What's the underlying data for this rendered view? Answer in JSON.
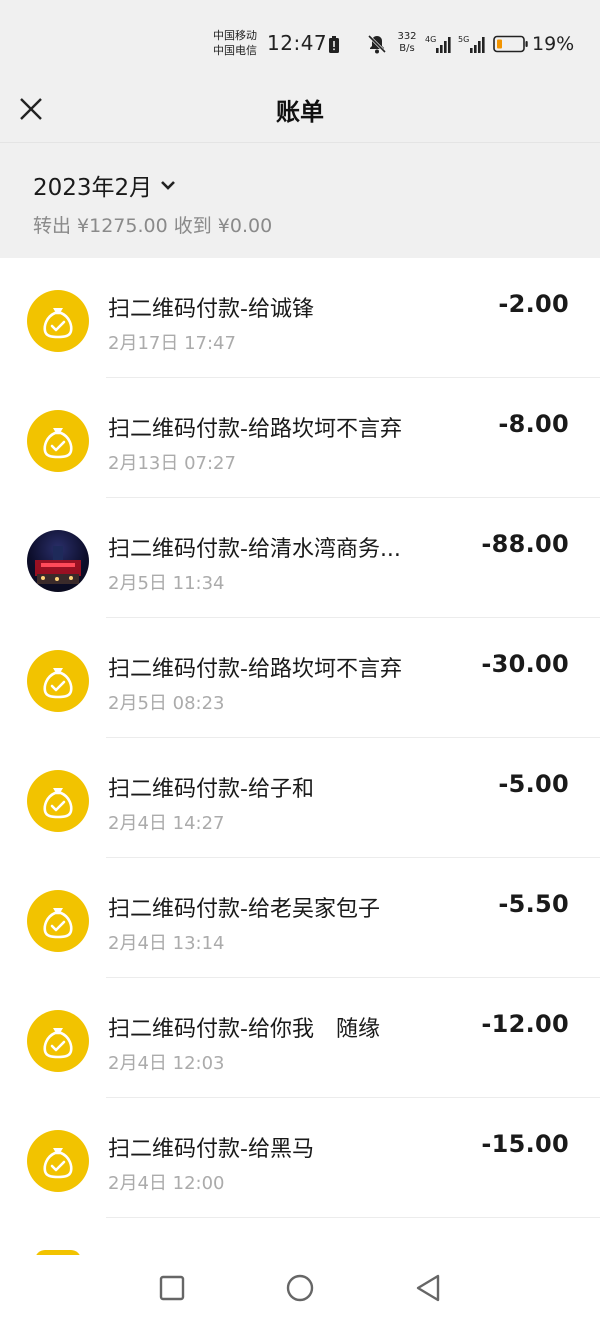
{
  "status_bar": {
    "carrier_1": "中国移动",
    "carrier_2": "中国电信",
    "time": "12:47",
    "net_speed_value": "332",
    "net_speed_unit": "B/s",
    "signal_1_label": "4G",
    "signal_2_label": "5G",
    "battery_percent": "19%"
  },
  "header": {
    "title": "账单",
    "close_icon": "close-icon"
  },
  "summary": {
    "month": "2023年2月",
    "totals": "转出 ¥1275.00 收到 ¥0.00"
  },
  "transactions": [
    {
      "title": "扫二维码付款-给诚锋",
      "date": "2月17日 17:47",
      "amount": "-2.00",
      "avatar": "money-bag-icon"
    },
    {
      "title": "扫二维码付款-给路坎坷不言弃",
      "date": "2月13日 07:27",
      "amount": "-8.00",
      "avatar": "money-bag-icon"
    },
    {
      "title": "扫二维码付款-给清水湾商务...",
      "date": "2月5日 11:34",
      "amount": "-88.00",
      "avatar": "merchant-photo"
    },
    {
      "title": "扫二维码付款-给路坎坷不言弃",
      "date": "2月5日 08:23",
      "amount": "-30.00",
      "avatar": "money-bag-icon"
    },
    {
      "title": "扫二维码付款-给子和",
      "date": "2月4日 14:27",
      "amount": "-5.00",
      "avatar": "money-bag-icon"
    },
    {
      "title": "扫二维码付款-给老吴家包子",
      "date": "2月4日 13:14",
      "amount": "-5.50",
      "avatar": "money-bag-icon"
    },
    {
      "title": "扫二维码付款-给你我　随缘",
      "date": "2月4日 12:03",
      "amount": "-12.00",
      "avatar": "money-bag-icon"
    },
    {
      "title": "扫二维码付款-给黑马",
      "date": "2月4日 12:00",
      "amount": "-15.00",
      "avatar": "money-bag-icon"
    }
  ],
  "colors": {
    "accent_yellow": "#f2c300",
    "background_gray": "#f0f0f0",
    "secondary_text": "#8a8a8a"
  },
  "navbar": {
    "icons": [
      "recents-square-icon",
      "home-circle-icon",
      "back-triangle-icon"
    ]
  }
}
